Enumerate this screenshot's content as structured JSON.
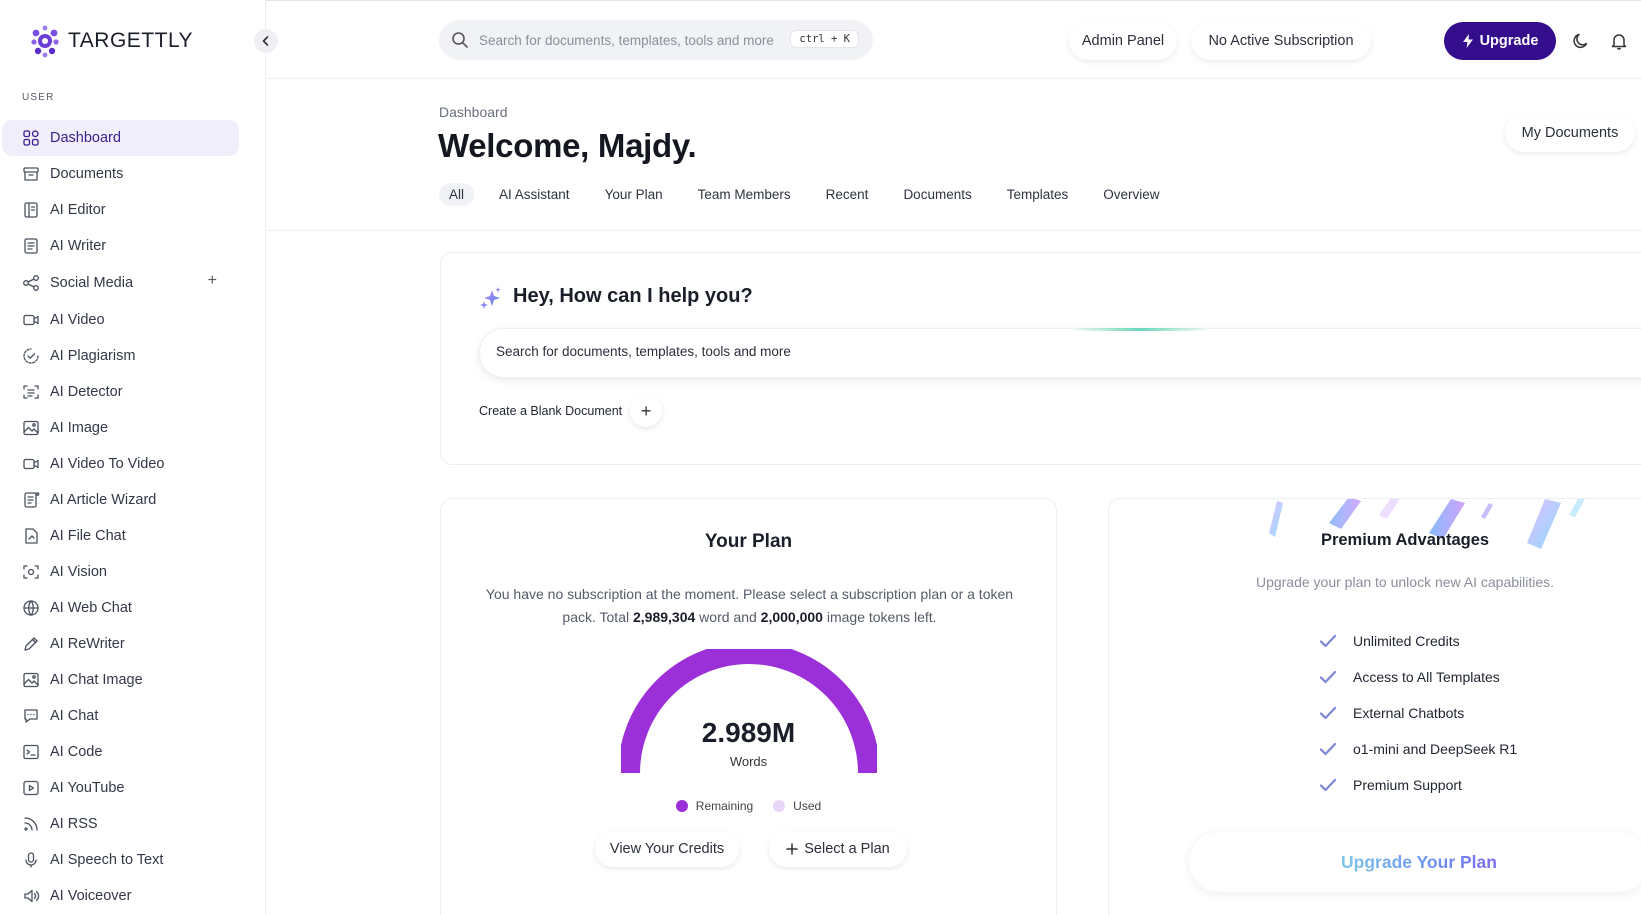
{
  "brand": {
    "name": "TARGETTLY",
    "accent": "#340d8c",
    "purple": "#9b30d9"
  },
  "sidebar": {
    "section_label": "USER",
    "items": [
      {
        "label": "Dashboard",
        "icon": "grid-icon",
        "active": true
      },
      {
        "label": "Documents",
        "icon": "archive-icon"
      },
      {
        "label": "AI Editor",
        "icon": "editor-icon"
      },
      {
        "label": "AI Writer",
        "icon": "doc-icon"
      },
      {
        "label": "Social Media",
        "icon": "share-icon",
        "expandable": true
      },
      {
        "label": "AI Video",
        "icon": "video-icon"
      },
      {
        "label": "AI Plagiarism",
        "icon": "check-circle-icon"
      },
      {
        "label": "AI Detector",
        "icon": "scan-icon"
      },
      {
        "label": "AI Image",
        "icon": "image-icon"
      },
      {
        "label": "AI Video To Video",
        "icon": "video-icon"
      },
      {
        "label": "AI Article Wizard",
        "icon": "article-icon"
      },
      {
        "label": "AI File Chat",
        "icon": "file-icon"
      },
      {
        "label": "AI Vision",
        "icon": "eye-scan-icon"
      },
      {
        "label": "AI Web Chat",
        "icon": "globe-icon"
      },
      {
        "label": "AI ReWriter",
        "icon": "pen-icon"
      },
      {
        "label": "AI Chat Image",
        "icon": "image-icon"
      },
      {
        "label": "AI Chat",
        "icon": "chat-icon"
      },
      {
        "label": "AI Code",
        "icon": "terminal-icon"
      },
      {
        "label": "AI YouTube",
        "icon": "play-icon"
      },
      {
        "label": "AI RSS",
        "icon": "rss-icon"
      },
      {
        "label": "AI Speech to Text",
        "icon": "mic-icon"
      },
      {
        "label": "AI Voiceover",
        "icon": "speaker-icon"
      }
    ]
  },
  "topbar": {
    "search_placeholder": "Search for documents, templates, tools and more",
    "shortcut": "ctrl + K",
    "admin_panel": "Admin Panel",
    "subscription": "No Active Subscription",
    "upgrade": "Upgrade"
  },
  "header": {
    "breadcrumb": "Dashboard",
    "title": "Welcome, Majdy.",
    "my_documents": "My Documents",
    "tabs": [
      "All",
      "AI Assistant",
      "Your Plan",
      "Team Members",
      "Recent",
      "Documents",
      "Templates",
      "Overview"
    ]
  },
  "help": {
    "title": "Hey, How can I help you?",
    "placeholder": "Search for documents, templates, tools and more",
    "blank_doc": "Create a Blank Document"
  },
  "plan": {
    "title": "Your Plan",
    "desc_before": "You have no subscription at the moment. Please select a subscription plan or a token pack. Total ",
    "words": "2,989,304",
    "desc_mid": " word and ",
    "images": "2,000,000",
    "desc_after": " image tokens left.",
    "gauge_value": "2.989M",
    "gauge_unit": "Words",
    "remaining_fraction": 1.0,
    "legend_remaining": "Remaining",
    "legend_used": "Used",
    "remaining_color": "#9b30d9",
    "used_color": "#ead6f7",
    "view_credits": "View Your Credits",
    "select_plan": "Select a Plan"
  },
  "premium": {
    "title": "Premium Advantages",
    "subtitle": "Upgrade your plan to unlock new AI capabilities.",
    "features": [
      "Unlimited Credits",
      "Access to All Templates",
      "External Chatbots",
      "o1-mini and DeepSeek R1",
      "Premium Support"
    ],
    "upgrade": "Upgrade Your Plan"
  }
}
